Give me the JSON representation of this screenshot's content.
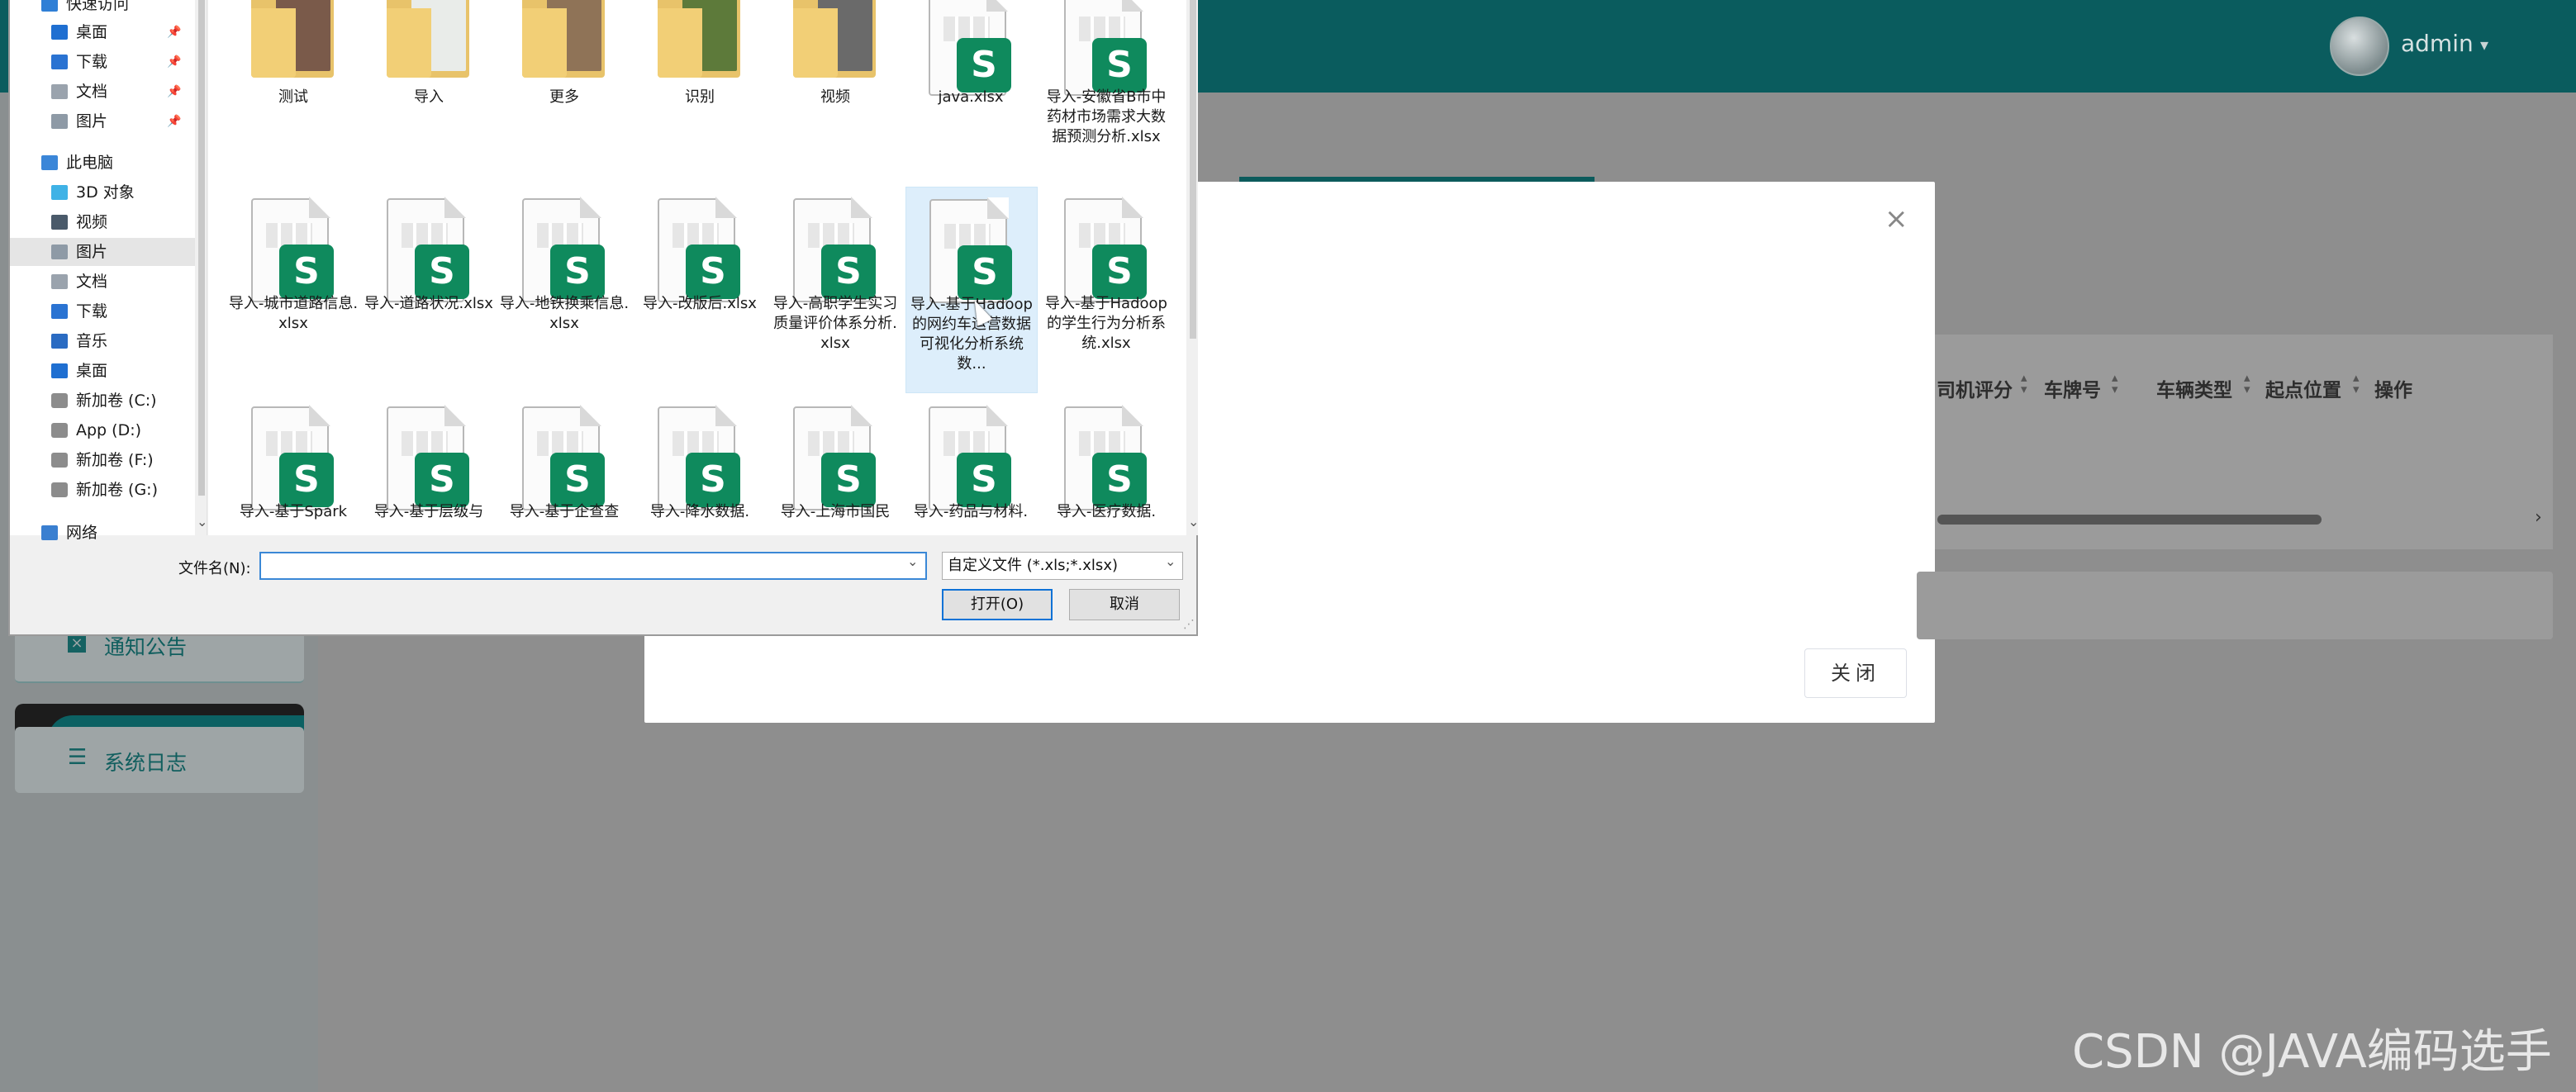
{
  "app": {
    "user": {
      "name": "admin",
      "caret": "▾"
    },
    "menu": [
      {
        "label": "通知公告",
        "icon": "close-square-icon"
      },
      {
        "label": "系统日志",
        "icon": "list-icon"
      }
    ],
    "table": {
      "headers": [
        "司机评分",
        "车牌号",
        "车辆类型",
        "起点位置",
        "操作"
      ],
      "scroll_arrow": "›"
    },
    "modal": {
      "close_icon": "×",
      "close_button": "关闭"
    },
    "colors": {
      "topbar": "#0a5c5e",
      "accent": "#0f8a5d",
      "dialog_focus": "#0f72d6"
    }
  },
  "dialog": {
    "nav_items": [
      {
        "label": "快速访问",
        "icon": "star-icon"
      },
      {
        "label": "桌面",
        "icon": "desktop-icon",
        "pinned": true
      },
      {
        "label": "下载",
        "icon": "download-icon",
        "pinned": true
      },
      {
        "label": "文档",
        "icon": "document-icon",
        "pinned": true
      },
      {
        "label": "图片",
        "icon": "picture-icon",
        "pinned": true
      },
      {
        "label": "此电脑",
        "icon": "computer-icon"
      },
      {
        "label": "3D 对象",
        "icon": "cube-icon"
      },
      {
        "label": "视频",
        "icon": "video-icon"
      },
      {
        "label": "图片",
        "icon": "picture-icon",
        "selected": true
      },
      {
        "label": "文档",
        "icon": "document-icon"
      },
      {
        "label": "下载",
        "icon": "download-icon"
      },
      {
        "label": "音乐",
        "icon": "music-icon"
      },
      {
        "label": "桌面",
        "icon": "desktop-icon"
      },
      {
        "label": "新加卷 (C:)",
        "icon": "drive-icon"
      },
      {
        "label": "App (D:)",
        "icon": "drive-icon"
      },
      {
        "label": "新加卷 (F:)",
        "icon": "drive-icon"
      },
      {
        "label": "新加卷 (G:)",
        "icon": "drive-icon"
      },
      {
        "label": "网络",
        "icon": "network-icon"
      }
    ],
    "pin_glyph": "📌",
    "files": [
      {
        "label": "测试",
        "type": "folder",
        "photo": "#7a5a4a"
      },
      {
        "label": "导入",
        "type": "folder",
        "photo": "#e9ece9"
      },
      {
        "label": "更多",
        "type": "folder",
        "photo": "#8f7357"
      },
      {
        "label": "识别",
        "type": "folder",
        "photo": "#5d7a3a"
      },
      {
        "label": "视频",
        "type": "folder",
        "photo": "#6a6a6a"
      },
      {
        "label": "java.xlsx",
        "type": "xlsx"
      },
      {
        "label": "导入-安徽省B市中药材市场需求大数据预测分析.xlsx",
        "type": "xlsx"
      },
      {
        "label": "导入-城市道路信息.xlsx",
        "type": "xlsx"
      },
      {
        "label": "导入-道路状况.xlsx",
        "type": "xlsx"
      },
      {
        "label": "导入-地铁换乘信息.xlsx",
        "type": "xlsx"
      },
      {
        "label": "导入-改版后.xlsx",
        "type": "xlsx"
      },
      {
        "label": "导入-高职学生实习质量评价体系分析.xlsx",
        "type": "xlsx"
      },
      {
        "label": "导入-基于Hadoop的网约车运营数据可视化分析系统数...",
        "type": "xlsx",
        "selected": true
      },
      {
        "label": "导入-基于Hadoop的学生行为分析系统.xlsx",
        "type": "xlsx"
      },
      {
        "label": "导入-基于Spark",
        "type": "xlsx"
      },
      {
        "label": "导入-基于层级与",
        "type": "xlsx"
      },
      {
        "label": "导入-基于企查查",
        "type": "xlsx"
      },
      {
        "label": "导入-降水数据.",
        "type": "xlsx"
      },
      {
        "label": "导入-上海市国民",
        "type": "xlsx"
      },
      {
        "label": "导入-药品与材料.",
        "type": "xlsx"
      },
      {
        "label": "导入-医疗数据.",
        "type": "xlsx"
      }
    ],
    "xlsx_glyph": "S",
    "filename_label": "文件名(N):",
    "filename_value": "",
    "filter": "自定义文件 (*.xls;*.xlsx)",
    "open_button": "打开(O)",
    "cancel_button": "取消"
  },
  "watermark": "CSDN @JAVA编码选手"
}
